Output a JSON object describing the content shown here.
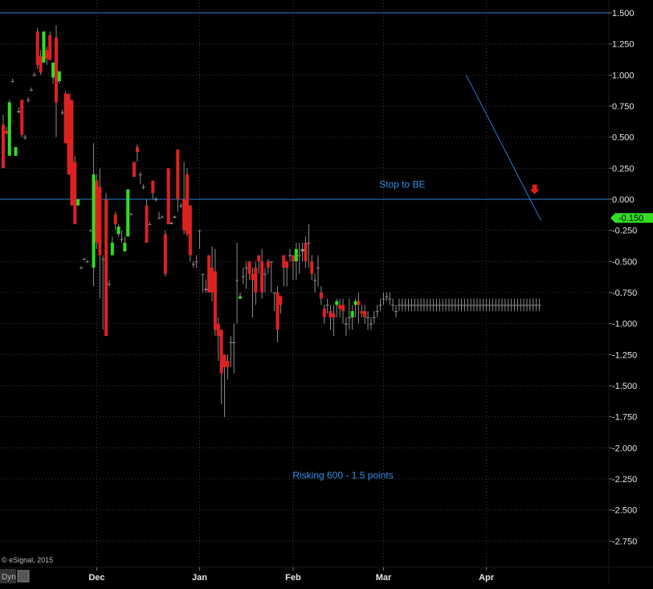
{
  "chart_data": {
    "type": "candlestick",
    "title": "",
    "ylim": [
      -2.9,
      1.6
    ],
    "y_ticks": [
      "1.500",
      "1.250",
      "1.000",
      "0.750",
      "0.500",
      "0.250",
      "0.000",
      "-0.250",
      "-0.500",
      "-0.750",
      "-1.000",
      "-1.250",
      "-1.500",
      "-1.750",
      "-2.000",
      "-2.250",
      "-2.500",
      "-2.750"
    ],
    "x_ticks": [
      {
        "label": "Dec",
        "x": 30
      },
      {
        "label": "Jan",
        "x": 63
      },
      {
        "label": "Feb",
        "x": 93
      },
      {
        "label": "Mar",
        "x": 122
      },
      {
        "label": "Apr",
        "x": 155
      }
    ],
    "horizontal_lines": [
      1.5,
      0.0
    ],
    "trendline": {
      "from": [
        148.5,
        1.0
      ],
      "to": [
        172.5,
        -0.17
      ]
    },
    "last_value": {
      "label": "-0.150",
      "value": -0.15
    },
    "arrow_marker": {
      "x": 170.5,
      "y": 0.08
    },
    "annotations": [
      {
        "text": "Stop to BE",
        "x": 128,
        "y": 0.12
      },
      {
        "text": "Risking 600 - 1.5 points",
        "x": 109,
        "y": -2.22
      }
    ],
    "copyright": "© eSignal, 2015",
    "bottom_badge": "Dyn",
    "candles": [
      [
        0,
        0.6,
        0.68,
        0.25,
        0.25
      ],
      [
        1,
        0.55,
        0.58,
        0.52,
        0.53
      ],
      [
        2,
        0.35,
        0.8,
        0.38,
        0.78
      ],
      [
        3,
        0.95,
        0.97,
        0.94,
        0.95
      ],
      [
        4,
        0.35,
        0.42,
        0.38,
        0.42
      ],
      [
        5,
        0.7,
        0.74,
        0.69,
        0.71
      ],
      [
        6,
        0.8,
        0.8,
        0.5,
        0.52
      ],
      [
        7,
        0.5,
        0.52,
        0.48,
        0.5
      ],
      [
        8,
        0.8,
        0.82,
        0.78,
        0.8
      ],
      [
        9,
        0.88,
        0.9,
        0.87,
        0.88
      ],
      [
        10,
        1.0,
        1.02,
        0.99,
        1.0
      ],
      [
        11,
        1.35,
        1.38,
        1.05,
        1.08
      ],
      [
        12,
        1.15,
        1.2,
        1.0,
        1.02
      ],
      [
        13,
        1.1,
        1.35,
        1.1,
        1.35
      ],
      [
        14,
        1.2,
        1.23,
        1.08,
        1.13
      ],
      [
        15,
        1.32,
        1.35,
        1.12,
        1.12
      ],
      [
        16,
        0.98,
        1.1,
        0.93,
        1.1
      ],
      [
        17,
        1.3,
        1.4,
        0.5,
        0.78
      ],
      [
        18,
        0.95,
        1.03,
        0.93,
        1.03
      ],
      [
        19,
        0.7,
        0.72,
        0.68,
        0.7
      ],
      [
        20,
        0.85,
        0.87,
        0.45,
        0.45
      ],
      [
        21,
        0.85,
        0.85,
        0.2,
        0.2
      ],
      [
        22,
        0.8,
        0.8,
        -0.05,
        -0.05
      ],
      [
        23,
        0.3,
        0.35,
        -0.2,
        -0.2
      ],
      [
        24,
        -0.05,
        0.0,
        -0.05,
        0.0
      ],
      [
        25,
        -0.55,
        -0.54,
        -0.56,
        -0.55
      ],
      [
        26,
        -0.48,
        -0.47,
        -0.49,
        -0.48
      ],
      [
        27,
        -0.5,
        -0.49,
        -0.51,
        -0.5
      ],
      [
        28,
        -0.25,
        -0.24,
        -0.26,
        -0.25
      ],
      [
        29,
        -0.55,
        0.45,
        -0.7,
        0.2
      ],
      [
        30,
        0.15,
        0.2,
        -0.4,
        -0.35
      ],
      [
        31,
        0.1,
        0.25,
        -0.8,
        -0.45
      ],
      [
        32,
        -0.48,
        -0.45,
        -1.05,
        -0.48
      ],
      [
        33,
        0.0,
        0.05,
        -1.1,
        -1.1
      ],
      [
        34,
        -0.68,
        -0.65,
        -0.7,
        -0.68
      ],
      [
        35,
        -0.45,
        -0.3,
        -0.4,
        -0.35
      ],
      [
        36,
        -0.12,
        -0.1,
        -0.25,
        -0.2
      ],
      [
        37,
        -0.28,
        -0.2,
        -0.3,
        -0.22
      ],
      [
        38,
        -0.32,
        -0.25,
        -0.35,
        -0.32
      ],
      [
        39,
        -0.42,
        -0.3,
        -0.4,
        -0.35
      ],
      [
        40,
        -0.3,
        0.08,
        -0.27,
        0.08
      ],
      [
        41,
        -0.12,
        -0.11,
        -0.13,
        -0.12
      ],
      [
        42,
        0.3,
        0.3,
        0.18,
        0.18
      ],
      [
        43,
        0.42,
        0.44,
        0.3,
        0.38
      ],
      [
        44,
        0.2,
        0.22,
        0.12,
        0.2
      ],
      [
        45,
        0.1,
        0.12,
        0.08,
        0.1
      ],
      [
        46,
        -0.05,
        0.0,
        -0.35,
        -0.35
      ],
      [
        47,
        -0.2,
        -0.18,
        -0.2,
        -0.2
      ],
      [
        48,
        0.15,
        0.15,
        0.0,
        0.05
      ],
      [
        49,
        0.0,
        0.02,
        -0.02,
        0.0
      ],
      [
        50,
        -0.15,
        -0.1,
        -0.15,
        -0.15
      ],
      [
        51,
        -0.14,
        -0.13,
        -0.15,
        -0.14
      ],
      [
        52,
        -0.28,
        -0.25,
        -0.62,
        -0.6
      ],
      [
        53,
        0.25,
        0.25,
        -0.2,
        -0.2
      ],
      [
        54,
        -0.2,
        -0.18,
        -0.2,
        -0.19
      ],
      [
        55,
        -0.15,
        -0.13,
        -0.15,
        -0.14
      ],
      [
        56,
        0.4,
        0.4,
        -0.1,
        0.0
      ],
      [
        57,
        -0.05,
        -0.03,
        -0.07,
        -0.05
      ],
      [
        58,
        0.0,
        0.3,
        -0.28,
        -0.25
      ],
      [
        59,
        0.2,
        0.25,
        -0.3,
        -0.28
      ],
      [
        60,
        -0.05,
        -0.05,
        -0.5,
        -0.45
      ],
      [
        61,
        -0.52,
        -0.5,
        -0.55,
        -0.52
      ],
      [
        62,
        -0.5,
        -0.45,
        -0.55,
        -0.5
      ],
      [
        63,
        -0.25,
        -0.25,
        -0.4,
        -0.25
      ],
      [
        64,
        -0.6,
        -0.6,
        -0.75,
        -0.6
      ],
      [
        65,
        -0.73,
        -0.65,
        -0.75,
        -0.72
      ],
      [
        66,
        -0.45,
        -0.45,
        -0.75,
        -0.75
      ],
      [
        67,
        -0.55,
        -0.38,
        -0.82,
        -0.75
      ],
      [
        68,
        -0.58,
        -0.4,
        -1.1,
        -1.05
      ],
      [
        69,
        -1.0,
        -0.95,
        -1.3,
        -1.1
      ],
      [
        70,
        -1.05,
        -1.05,
        -1.65,
        -1.4
      ],
      [
        71,
        -1.25,
        -1.25,
        -1.75,
        -1.35
      ],
      [
        72,
        -1.3,
        -1.25,
        -1.45,
        -1.35
      ],
      [
        73,
        -1.15,
        -1.1,
        -1.35,
        -1.15
      ],
      [
        74,
        -1.15,
        -1.0,
        -1.4,
        -1.15
      ],
      [
        75,
        -0.65,
        -0.35,
        -1.0,
        -0.65
      ],
      [
        76,
        -0.8,
        -0.75,
        -0.8,
        -0.78
      ],
      [
        77,
        -0.62,
        -0.55,
        -0.68,
        -0.62
      ],
      [
        78,
        -0.55,
        -0.5,
        -0.72,
        -0.55
      ],
      [
        79,
        -0.5,
        -0.5,
        -0.65,
        -0.6
      ],
      [
        80,
        -0.6,
        -0.55,
        -0.95,
        -0.65
      ],
      [
        81,
        -0.55,
        -0.5,
        -0.85,
        -0.75
      ],
      [
        82,
        -0.45,
        -0.45,
        -0.6,
        -0.5
      ],
      [
        83,
        -0.5,
        -0.4,
        -0.8,
        -0.75
      ],
      [
        84,
        -0.6,
        -0.55,
        -0.75,
        -0.6
      ],
      [
        85,
        -0.5,
        -0.48,
        -0.6,
        -0.55
      ],
      [
        86,
        -0.5,
        -0.5,
        -0.75,
        -0.5
      ],
      [
        87,
        -0.75,
        -0.75,
        -0.9,
        -0.75
      ],
      [
        88,
        -0.75,
        -0.7,
        -1.15,
        -1.05
      ],
      [
        89,
        -0.78,
        -0.78,
        -0.92,
        -0.85
      ],
      [
        90,
        -0.45,
        -0.45,
        -0.7,
        -0.55
      ],
      [
        91,
        -0.5,
        -0.5,
        -0.7,
        -0.55
      ],
      [
        92,
        -0.45,
        -0.4,
        -0.5,
        -0.45
      ],
      [
        93,
        -0.45,
        -0.45,
        -0.65,
        -0.5
      ],
      [
        94,
        -0.5,
        -0.35,
        -0.65,
        -0.4
      ],
      [
        95,
        -0.45,
        -0.35,
        -0.6,
        -0.45
      ],
      [
        96,
        -0.4,
        -0.35,
        -0.5,
        -0.42
      ],
      [
        97,
        -0.35,
        -0.3,
        -0.55,
        -0.5
      ],
      [
        98,
        -0.35,
        -0.2,
        -0.55,
        -0.35
      ],
      [
        99,
        -0.5,
        -0.45,
        -0.65,
        -0.6
      ],
      [
        100,
        -0.65,
        -0.6,
        -0.75,
        -0.65
      ],
      [
        101,
        -0.55,
        -0.45,
        -0.7,
        -0.55
      ],
      [
        102,
        -0.75,
        -0.7,
        -0.85,
        -0.8
      ],
      [
        103,
        -0.88,
        -0.85,
        -1.0,
        -0.95
      ],
      [
        104,
        -0.85,
        -0.8,
        -0.92,
        -0.85
      ],
      [
        105,
        -0.9,
        -0.85,
        -1.05,
        -0.95
      ],
      [
        106,
        -0.92,
        -0.85,
        -1.1,
        -0.95
      ],
      [
        107,
        -0.85,
        -0.8,
        -0.95,
        -0.82
      ],
      [
        108,
        -0.85,
        -0.8,
        -0.95,
        -0.88
      ],
      [
        109,
        -0.85,
        -0.8,
        -1.0,
        -0.9
      ],
      [
        110,
        -1.0,
        -0.95,
        -1.1,
        -1.0
      ],
      [
        111,
        -0.95,
        -0.8,
        -1.05,
        -0.95
      ],
      [
        112,
        -0.95,
        -0.85,
        -1.05,
        -0.9
      ],
      [
        113,
        -0.85,
        -0.8,
        -0.95,
        -0.82
      ],
      [
        114,
        -0.82,
        -0.75,
        -1.0,
        -0.85
      ],
      [
        115,
        -0.9,
        -0.85,
        -0.95,
        -0.92
      ],
      [
        116,
        -0.9,
        -0.85,
        -1.0,
        -0.95
      ],
      [
        117,
        -0.95,
        -0.9,
        -1.05,
        -0.95
      ],
      [
        118,
        -1.0,
        -0.95,
        -1.05,
        -1.0
      ],
      [
        119,
        -0.95,
        -0.9,
        -1.0,
        -0.95
      ],
      [
        120,
        -0.9,
        -0.85,
        -0.95,
        -0.9
      ],
      [
        121,
        -0.85,
        -0.8,
        -0.9,
        -0.85
      ],
      [
        122,
        -0.8,
        -0.75,
        -0.85,
        -0.8
      ],
      [
        123,
        -0.78,
        -0.75,
        -0.82,
        -0.78
      ],
      [
        124,
        -0.8,
        -0.75,
        -0.85,
        -0.8
      ],
      [
        125,
        -0.85,
        -0.8,
        -0.9,
        -0.85
      ],
      [
        126,
        -0.9,
        -0.85,
        -0.95,
        -0.9
      ],
      [
        127,
        -0.85,
        -0.8,
        -0.9,
        -0.85
      ],
      [
        128,
        -0.85,
        -0.8,
        -0.9,
        -0.85
      ],
      [
        129,
        -0.85,
        -0.8,
        -0.9,
        -0.85
      ],
      [
        130,
        -0.85,
        -0.8,
        -0.9,
        -0.85
      ],
      [
        131,
        -0.85,
        -0.8,
        -0.9,
        -0.85
      ],
      [
        132,
        -0.85,
        -0.8,
        -0.9,
        -0.85
      ],
      [
        133,
        -0.85,
        -0.8,
        -0.9,
        -0.85
      ],
      [
        134,
        -0.85,
        -0.8,
        -0.9,
        -0.85
      ],
      [
        135,
        -0.85,
        -0.8,
        -0.9,
        -0.85
      ],
      [
        136,
        -0.85,
        -0.8,
        -0.9,
        -0.85
      ],
      [
        137,
        -0.85,
        -0.8,
        -0.9,
        -0.85
      ],
      [
        138,
        -0.85,
        -0.8,
        -0.9,
        -0.85
      ],
      [
        139,
        -0.85,
        -0.8,
        -0.9,
        -0.85
      ],
      [
        140,
        -0.85,
        -0.8,
        -0.9,
        -0.85
      ],
      [
        141,
        -0.85,
        -0.8,
        -0.9,
        -0.85
      ],
      [
        142,
        -0.85,
        -0.8,
        -0.9,
        -0.85
      ],
      [
        143,
        -0.85,
        -0.8,
        -0.9,
        -0.85
      ],
      [
        144,
        -0.85,
        -0.8,
        -0.9,
        -0.85
      ],
      [
        145,
        -0.85,
        -0.8,
        -0.9,
        -0.85
      ],
      [
        146,
        -0.85,
        -0.8,
        -0.9,
        -0.85
      ],
      [
        147,
        -0.85,
        -0.8,
        -0.9,
        -0.85
      ],
      [
        148,
        -0.85,
        -0.8,
        -0.9,
        -0.85
      ],
      [
        149,
        -0.85,
        -0.8,
        -0.9,
        -0.85
      ],
      [
        150,
        -0.85,
        -0.8,
        -0.9,
        -0.85
      ],
      [
        151,
        -0.85,
        -0.8,
        -0.9,
        -0.85
      ],
      [
        152,
        -0.85,
        -0.8,
        -0.9,
        -0.85
      ],
      [
        153,
        -0.85,
        -0.8,
        -0.9,
        -0.85
      ],
      [
        154,
        -0.85,
        -0.8,
        -0.9,
        -0.85
      ],
      [
        155,
        -0.85,
        -0.8,
        -0.9,
        -0.85
      ],
      [
        156,
        -0.85,
        -0.8,
        -0.9,
        -0.85
      ],
      [
        157,
        -0.85,
        -0.8,
        -0.9,
        -0.85
      ],
      [
        158,
        -0.85,
        -0.8,
        -0.9,
        -0.85
      ],
      [
        159,
        -0.85,
        -0.8,
        -0.9,
        -0.85
      ],
      [
        160,
        -0.85,
        -0.8,
        -0.9,
        -0.85
      ],
      [
        161,
        -0.85,
        -0.8,
        -0.9,
        -0.85
      ],
      [
        162,
        -0.85,
        -0.8,
        -0.9,
        -0.85
      ],
      [
        163,
        -0.85,
        -0.8,
        -0.9,
        -0.85
      ],
      [
        164,
        -0.85,
        -0.8,
        -0.9,
        -0.85
      ],
      [
        165,
        -0.85,
        -0.8,
        -0.9,
        -0.85
      ],
      [
        166,
        -0.85,
        -0.8,
        -0.9,
        -0.85
      ],
      [
        167,
        -0.85,
        -0.8,
        -0.9,
        -0.85
      ],
      [
        168,
        -0.85,
        -0.8,
        -0.9,
        -0.85
      ],
      [
        169,
        -0.85,
        -0.8,
        -0.9,
        -0.85
      ],
      [
        170,
        -0.85,
        -0.8,
        -0.9,
        -0.85
      ],
      [
        171,
        -0.85,
        -0.8,
        -0.9,
        -0.85
      ],
      [
        172,
        -0.85,
        -0.8,
        -0.9,
        -0.85
      ],
      [
        173,
        -0.85,
        -0.8,
        -0.9,
        -0.85
      ],
      [
        174,
        -0.85,
        -0.8,
        -0.9,
        -0.85
      ],
      [
        175,
        -0.85,
        -0.8,
        -0.9,
        -0.85
      ],
      [
        176,
        -0.85,
        -0.8,
        -0.9,
        -0.85
      ],
      [
        177,
        -0.85,
        -0.8,
        -0.9,
        -0.85
      ],
      [
        178,
        -0.85,
        -0.8,
        -0.9,
        -0.85
      ],
      [
        179,
        -0.85,
        -0.8,
        -0.9,
        -0.85
      ],
      [
        180,
        -0.85,
        -0.8,
        -0.9,
        -0.85
      ],
      [
        181,
        -0.85,
        -0.8,
        -0.9,
        -0.85
      ],
      [
        182,
        -0.85,
        -0.8,
        -0.9,
        -0.85
      ],
      [
        183,
        -0.85,
        -0.8,
        -0.9,
        -0.85
      ],
      [
        184,
        -0.85,
        -0.8,
        -0.9,
        -0.85
      ]
    ],
    "colors": {
      "background": "#000000",
      "grid": "#3c3c3c",
      "up": "#33dd22",
      "down": "#dd2222",
      "neutral": "#8c8c8c",
      "hline": "#2a7fd4",
      "trendline": "#2a7fd4",
      "annotation": "#2f8fe6",
      "axis_text": "#e6e6e6",
      "last_value_bg": "#33dd22",
      "arrow": "#e21a1a"
    }
  }
}
